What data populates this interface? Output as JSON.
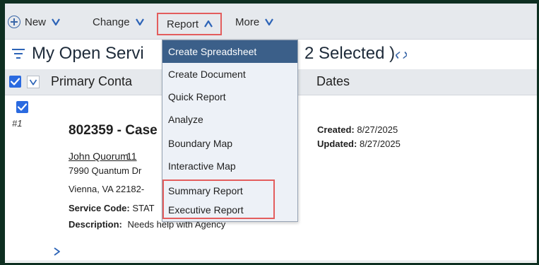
{
  "toolbar": {
    "new_label": "New",
    "change_label": "Change",
    "report_label": "Report",
    "more_label": "More"
  },
  "view": {
    "title": "My Open Servi",
    "title_tail": "2 Selected )"
  },
  "grid": {
    "columns": [
      "Primary Conta",
      "Dates"
    ]
  },
  "record": {
    "row_number": "#1",
    "title": "802359 - Case",
    "contact_name": "John Quorum",
    "contact_extra": "11",
    "address_line1": "7990 Quantum Dr",
    "address_line2": "Vienna, VA 22182-",
    "service_code_label": "Service Code:",
    "service_code_value": "STAT",
    "description_label": "Description:",
    "description_value": "Needs help with Agency",
    "created_label": "Created:",
    "created_value": "8/27/2025",
    "updated_label": "Updated:",
    "updated_value": "8/27/2025"
  },
  "report_menu": {
    "items": [
      "Create Spreadsheet",
      "Create Document",
      "Quick Report",
      "Analyze",
      "Boundary Map",
      "Interactive Map",
      "Summary Report",
      "Executive Report"
    ],
    "active_index": 0
  },
  "colors": {
    "accent_blue": "#2a6ae0",
    "menu_active": "#3b5f89",
    "highlight_red": "#e35d5d",
    "frame": "#0e2f21"
  },
  "icons": {
    "new": "plus-circle-icon",
    "chevron": "chevron-down-icon",
    "filter": "filter-lines-icon",
    "refresh": "refresh-arrows-icon",
    "next": "chevron-right-icon"
  }
}
